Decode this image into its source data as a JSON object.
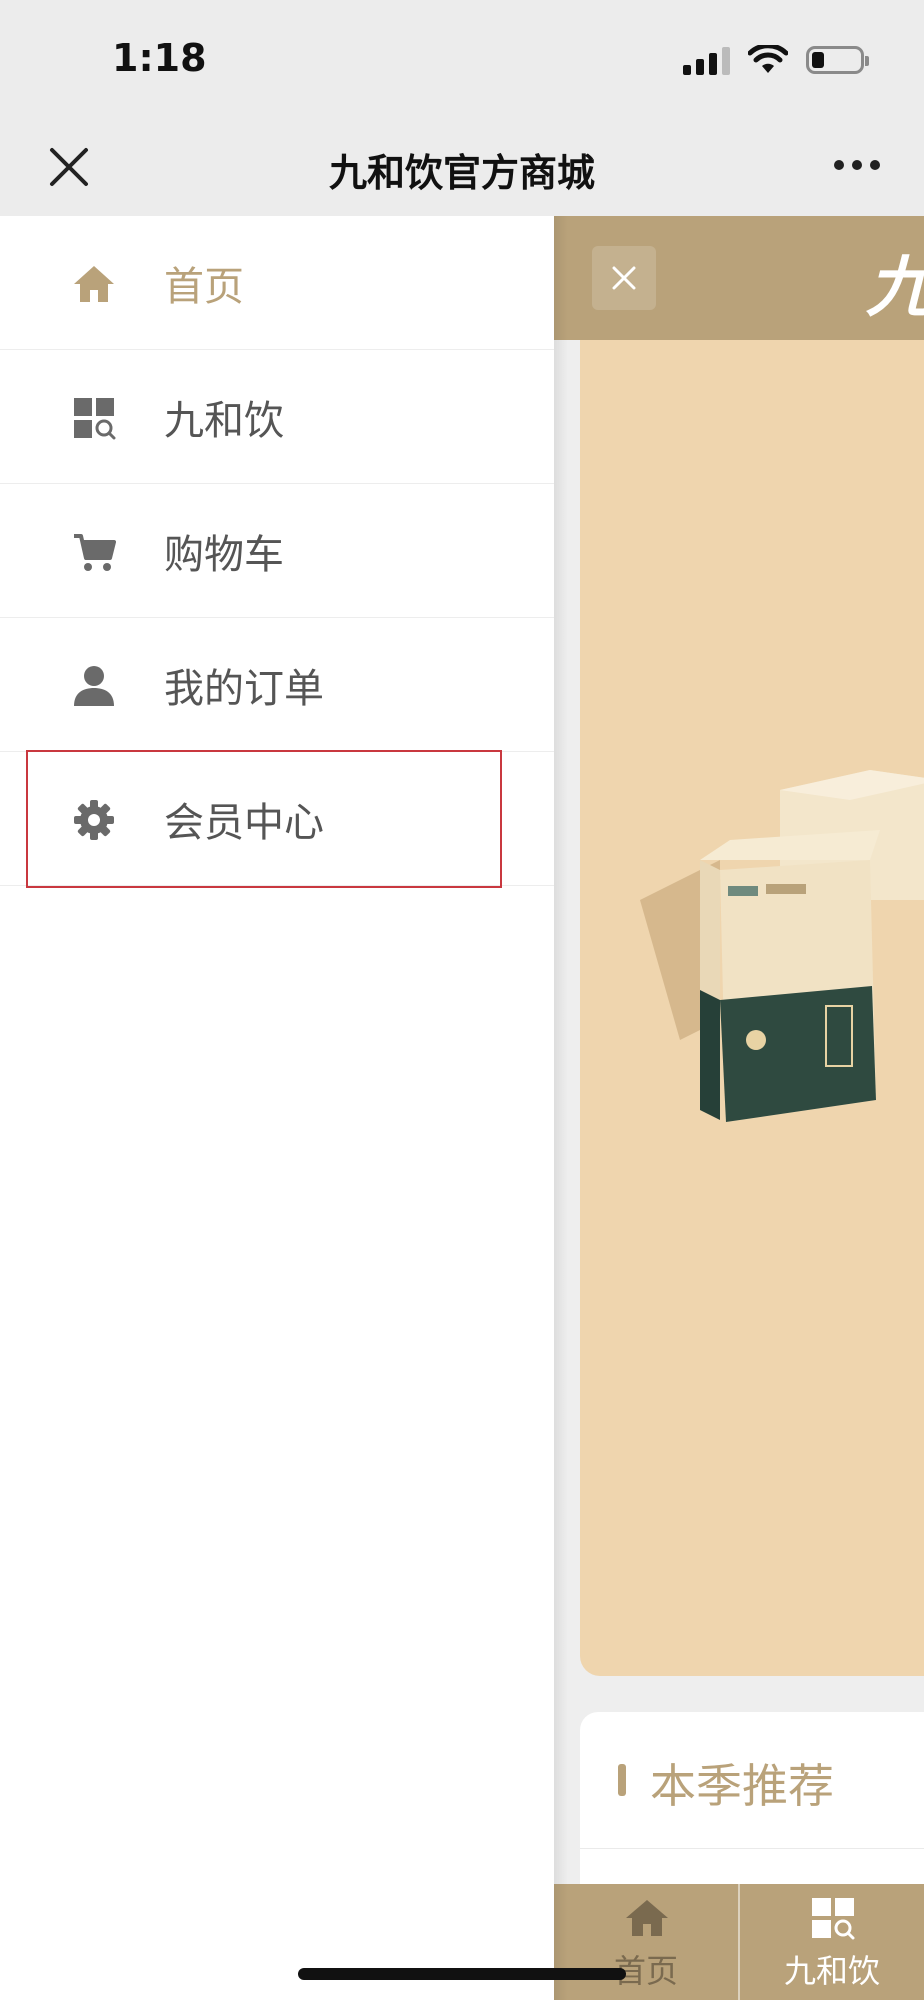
{
  "status_bar": {
    "time": "1:18"
  },
  "nav_bar": {
    "title": "九和饮官方商城"
  },
  "menu": {
    "items": [
      {
        "label": "首页",
        "icon": "home-icon",
        "active": true
      },
      {
        "label": "九和饮",
        "icon": "grid-search-icon",
        "active": false
      },
      {
        "label": "购物车",
        "icon": "cart-icon",
        "active": false
      },
      {
        "label": "我的订单",
        "icon": "user-icon",
        "active": false
      },
      {
        "label": "会员中心",
        "icon": "gear-icon",
        "active": false,
        "highlighted": true
      }
    ]
  },
  "page": {
    "logo_text": "九",
    "section_title": "本季推荐",
    "tabbar": {
      "home_label": "首页",
      "shop_label": "九和饮"
    }
  },
  "colors": {
    "accent": "#b9a27a",
    "banner": "#efd5ae",
    "highlight_border": "#c9383f",
    "menu_text": "#555555",
    "icon_gray": "#6a6a6a"
  }
}
